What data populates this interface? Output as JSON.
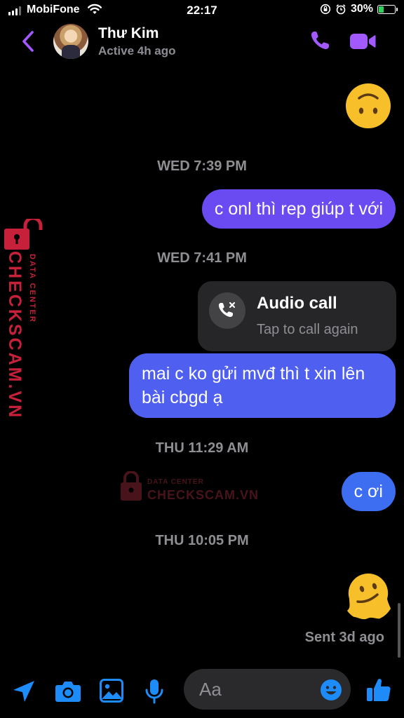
{
  "status_bar": {
    "carrier": "MobiFone",
    "time": "22:17",
    "battery": "30%",
    "battery_level": 0.3,
    "icons": [
      "signal-icon",
      "wifi-icon",
      "orientation-lock-icon",
      "alarm-icon",
      "battery-charging-icon"
    ]
  },
  "header": {
    "contact_name": "Thư Kim",
    "contact_status": "Active 4h ago",
    "icons": [
      "back-chevron-icon",
      "phone-icon",
      "video-camera-icon"
    ],
    "accent_color": "#a259ff"
  },
  "messages": [
    {
      "type": "emoji",
      "icon": "upside-down-face-icon"
    },
    {
      "type": "timestamp",
      "text": "WED 7:39 PM"
    },
    {
      "type": "outgoing",
      "text": "c onl thì rep giúp t với"
    },
    {
      "type": "timestamp",
      "text": "WED 7:41 PM"
    },
    {
      "type": "call",
      "title": "Audio call",
      "subtitle": "Tap to call again",
      "icon": "missed-call-icon"
    },
    {
      "type": "outgoing",
      "text": "mai c ko gửi mvđ thì t xin lên bài cbgd ạ"
    },
    {
      "type": "timestamp",
      "text": "THU 11:29 AM"
    },
    {
      "type": "outgoing",
      "text": "c ơi"
    },
    {
      "type": "timestamp",
      "text": "THU 10:05 PM"
    },
    {
      "type": "emoji",
      "icon": "melting-face-icon"
    }
  ],
  "receipt": "Sent 3d ago",
  "watermark": {
    "small_text": "DATA CENTER",
    "big_text": "CHECKSCAM.VN",
    "color": "#c6203a"
  },
  "composer": {
    "placeholder": "Aa",
    "icons": [
      "location-icon",
      "camera-icon",
      "gallery-icon",
      "microphone-icon",
      "emoji-icon",
      "thumbs-up-icon"
    ],
    "accent_color": "#1d8cf8"
  }
}
